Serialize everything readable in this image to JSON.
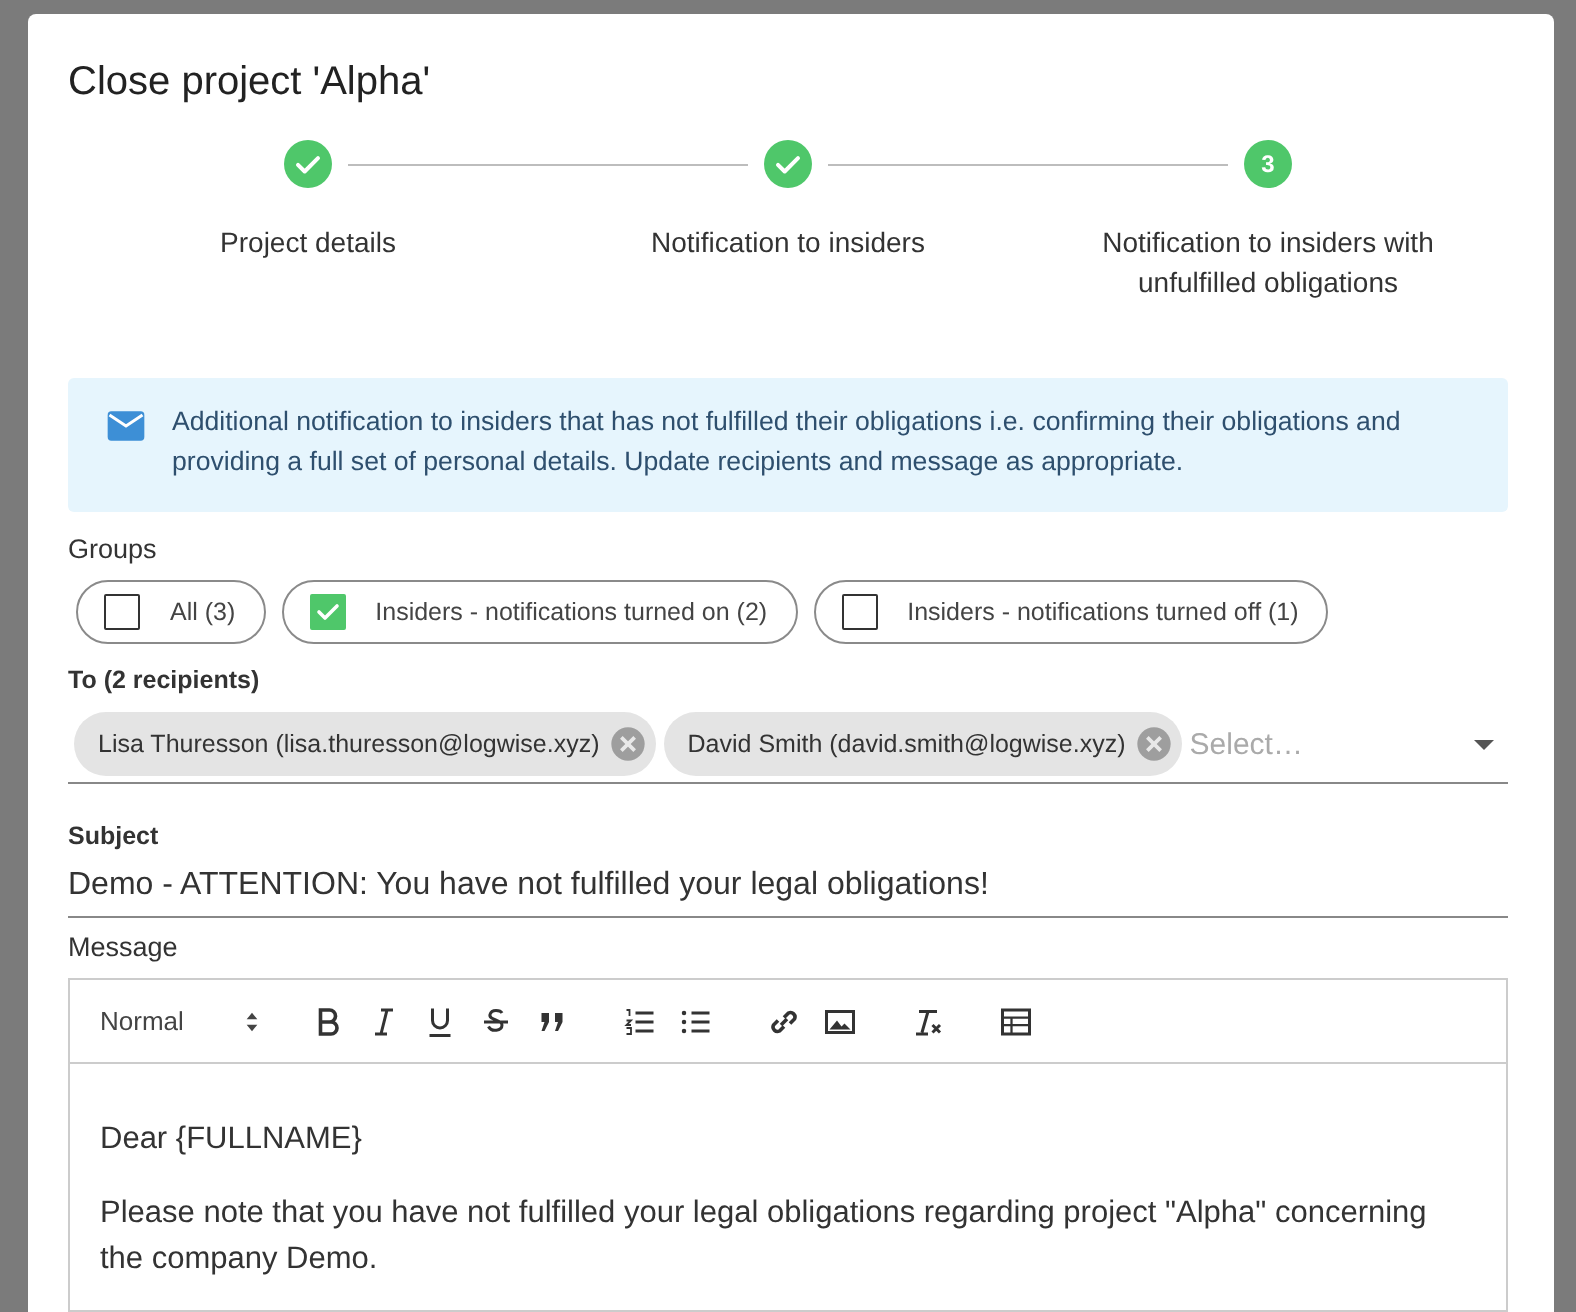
{
  "dialog": {
    "title": "Close project 'Alpha'"
  },
  "steps": [
    {
      "label": "Project details",
      "completed": true
    },
    {
      "label": "Notification to insiders",
      "completed": true
    },
    {
      "label": "Notification to insiders with unfulfilled obligations",
      "completed": false,
      "number": "3"
    }
  ],
  "info": {
    "text": "Additional notification to insiders that has not fulfilled their obligations i.e. confirming their obligations and providing a full set of personal details. Update recipients and message as appropriate."
  },
  "groups": {
    "label": "Groups",
    "options": [
      {
        "label": "All (3)",
        "checked": false
      },
      {
        "label": "Insiders - notifications turned on (2)",
        "checked": true
      },
      {
        "label": "Insiders - notifications turned off (1)",
        "checked": false
      }
    ]
  },
  "to": {
    "label": "To (2 recipients)",
    "placeholder": "Select…",
    "recipients": [
      {
        "label": "Lisa Thuresson (lisa.thuresson@logwise.xyz)"
      },
      {
        "label": "David Smith (david.smith@logwise.xyz)"
      }
    ]
  },
  "subject": {
    "label": "Subject",
    "value": "Demo - ATTENTION: You have not fulfilled your legal obligations!"
  },
  "message": {
    "label": "Message",
    "format": "Normal",
    "paragraphs": [
      "Dear {FULLNAME}",
      "Please note that you have not fulfilled your legal obligations regarding project \"Alpha\" concerning the company Demo."
    ]
  }
}
